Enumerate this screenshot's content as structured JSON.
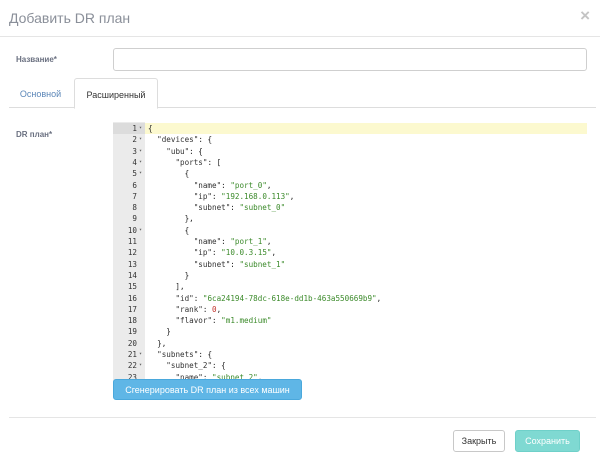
{
  "dialog": {
    "title": "Добавить DR план",
    "close_glyph": "×"
  },
  "form": {
    "name_label": "Название*",
    "name_value": "",
    "name_placeholder": "",
    "dr_plan_label": "DR план*"
  },
  "tabs": [
    {
      "label": "Основной",
      "active": false
    },
    {
      "label": "Расширенный",
      "active": true
    }
  ],
  "editor": {
    "active_line": 1,
    "lines": [
      {
        "no": "1",
        "fold": true,
        "text": "{"
      },
      {
        "no": "2",
        "fold": true,
        "text": "  \"devices\": {"
      },
      {
        "no": "3",
        "fold": true,
        "text": "    \"ubu\": {"
      },
      {
        "no": "4",
        "fold": true,
        "text": "      \"ports\": ["
      },
      {
        "no": "5",
        "fold": true,
        "text": "        {"
      },
      {
        "no": "6",
        "fold": false,
        "text": "          \"name\": \"port_0\","
      },
      {
        "no": "7",
        "fold": false,
        "text": "          \"ip\": \"192.168.0.113\","
      },
      {
        "no": "8",
        "fold": false,
        "text": "          \"subnet\": \"subnet_0\""
      },
      {
        "no": "9",
        "fold": false,
        "text": "        },"
      },
      {
        "no": "10",
        "fold": true,
        "text": "        {"
      },
      {
        "no": "11",
        "fold": false,
        "text": "          \"name\": \"port_1\","
      },
      {
        "no": "12",
        "fold": false,
        "text": "          \"ip\": \"10.0.3.15\","
      },
      {
        "no": "13",
        "fold": false,
        "text": "          \"subnet\": \"subnet_1\""
      },
      {
        "no": "14",
        "fold": false,
        "text": "        }"
      },
      {
        "no": "15",
        "fold": false,
        "text": "      ],"
      },
      {
        "no": "16",
        "fold": false,
        "text": "      \"id\": \"6ca24194-78dc-618e-dd1b-463a550669b9\","
      },
      {
        "no": "17",
        "fold": false,
        "text": "      \"rank\": 0,"
      },
      {
        "no": "18",
        "fold": false,
        "text": "      \"flavor\": \"m1.medium\""
      },
      {
        "no": "19",
        "fold": false,
        "text": "    }"
      },
      {
        "no": "20",
        "fold": false,
        "text": "  },"
      },
      {
        "no": "21",
        "fold": true,
        "text": "  \"subnets\": {"
      },
      {
        "no": "22",
        "fold": true,
        "text": "    \"subnet_2\": {"
      },
      {
        "no": "23",
        "fold": false,
        "text": "      \"name\": \"subnet_2\","
      }
    ]
  },
  "buttons": {
    "generate": "Сгенерировать DR план из всех машин",
    "close": "Закрыть",
    "save": "Сохранить"
  }
}
